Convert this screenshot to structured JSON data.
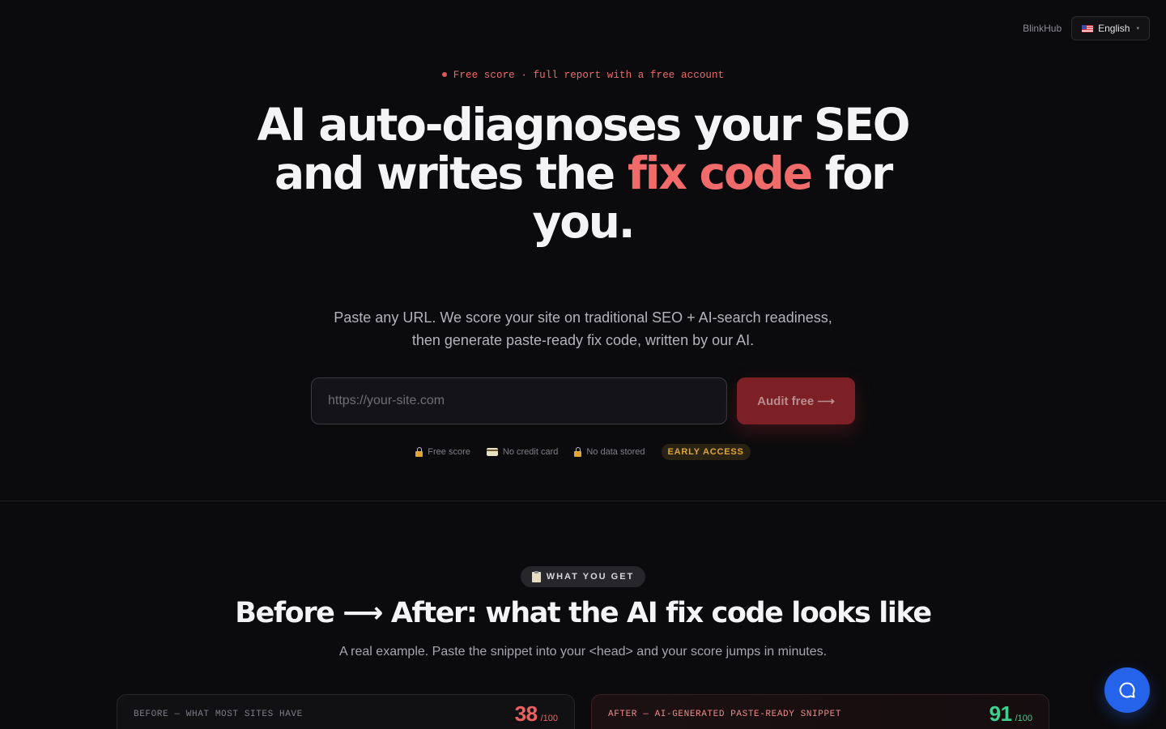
{
  "header": {
    "brand": "BlinkHub",
    "language": {
      "label": "English",
      "flag_icon": "us-flag-icon"
    }
  },
  "hero": {
    "eyebrow": "Free score · full report with a free account",
    "headline": {
      "line1": "AI auto-diagnoses your SEO",
      "line2_pre": "and writes the",
      "line2_accent": "fix code",
      "line2_post": "for you."
    },
    "subhead": "Paste any URL. We score your site on traditional SEO + AI-search readiness, then generate paste-ready fix code, written by our AI.",
    "url_input": {
      "placeholder": "https://your-site.com",
      "value": ""
    },
    "audit_button": "Audit free ⟶",
    "trust": [
      {
        "icon": "lock-icon",
        "label": "Free score"
      },
      {
        "icon": "credit-card-icon",
        "label": "No credit card"
      },
      {
        "icon": "lock-icon",
        "label": "No data stored"
      }
    ],
    "badge": "EARLY ACCESS"
  },
  "section": {
    "pill": {
      "icon": "clipboard-icon",
      "label": "WHAT YOU GET"
    },
    "title": "Before ⟶ After: what the AI fix code looks like",
    "subtitle": "A real example. Paste the snippet into your <head> and your score jumps in minutes.",
    "before": {
      "label": "BEFORE — WHAT MOST SITES HAVE",
      "score": "38",
      "out_of": "/100"
    },
    "after": {
      "label": "AFTER — AI-GENERATED PASTE-READY SNIPPET",
      "score": "91",
      "out_of": "/100"
    }
  },
  "colors": {
    "accent": "#f26b6b",
    "button": "#7d2025",
    "early_access": "#e0a631",
    "score_bad": "#f0605e",
    "score_good": "#3fcf8e",
    "chat": "#2563eb"
  },
  "chat": {
    "icon": "chat-bubble-icon"
  }
}
